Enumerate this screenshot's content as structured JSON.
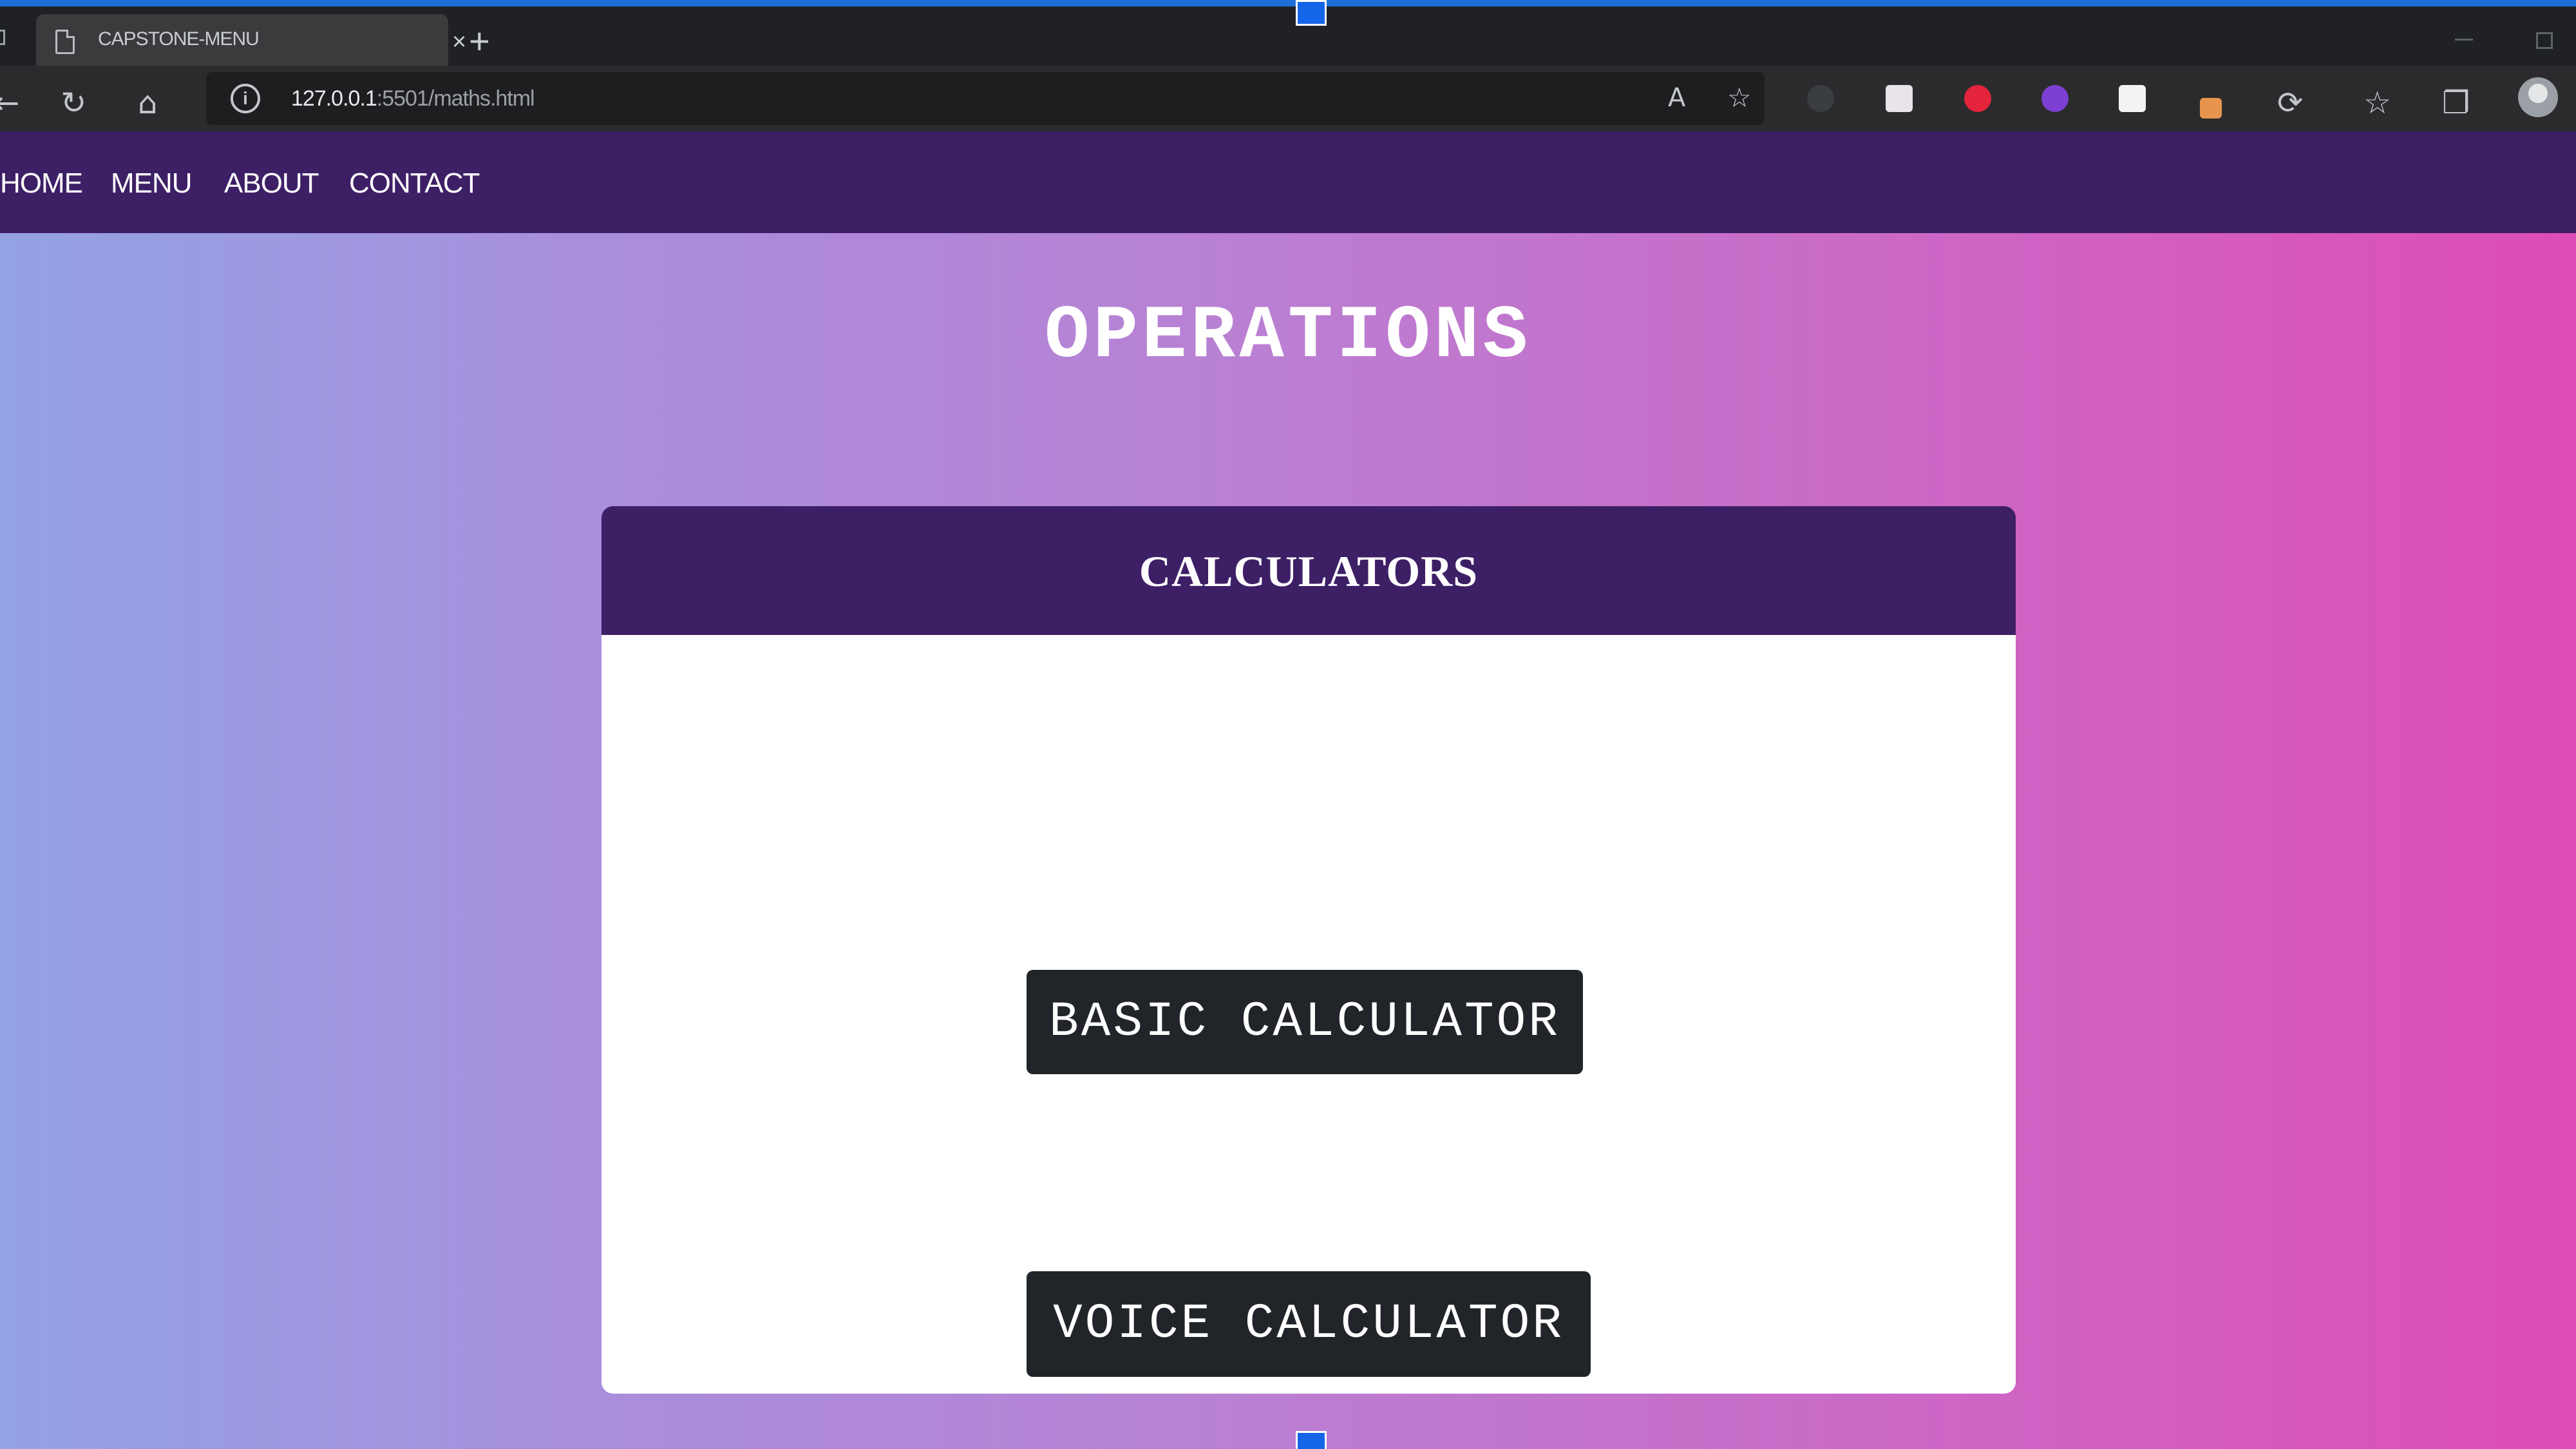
{
  "browser": {
    "tab_title": "CAPSTONE-MENU",
    "tab_close": "×",
    "new_tab": "+",
    "url_host": "127.0.0.1",
    "url_path": ":5501/maths.html",
    "icons": [
      "back-icon",
      "reload-icon",
      "home-icon",
      "info-icon",
      "read-aloud-icon",
      "add-favorite-icon",
      "extension-icons",
      "refresh-icon",
      "favorites-icon",
      "collections-icon",
      "profile-icon"
    ]
  },
  "nav": {
    "items": [
      {
        "label": "HOME"
      },
      {
        "label": "MENU"
      },
      {
        "label": "ABOUT"
      },
      {
        "label": "CONTACT"
      }
    ]
  },
  "main": {
    "title": "OPERATIONS",
    "card": {
      "header": "CALCULATORS",
      "buttons": [
        {
          "label": "BASIC CALCULATOR"
        },
        {
          "label": "VOICE CALCULATOR"
        }
      ]
    }
  },
  "colors": {
    "nav_bg": "#3d1f66",
    "button_bg": "#212529",
    "gradient_start": "#93a3e4",
    "gradient_end": "#de4cb9"
  }
}
